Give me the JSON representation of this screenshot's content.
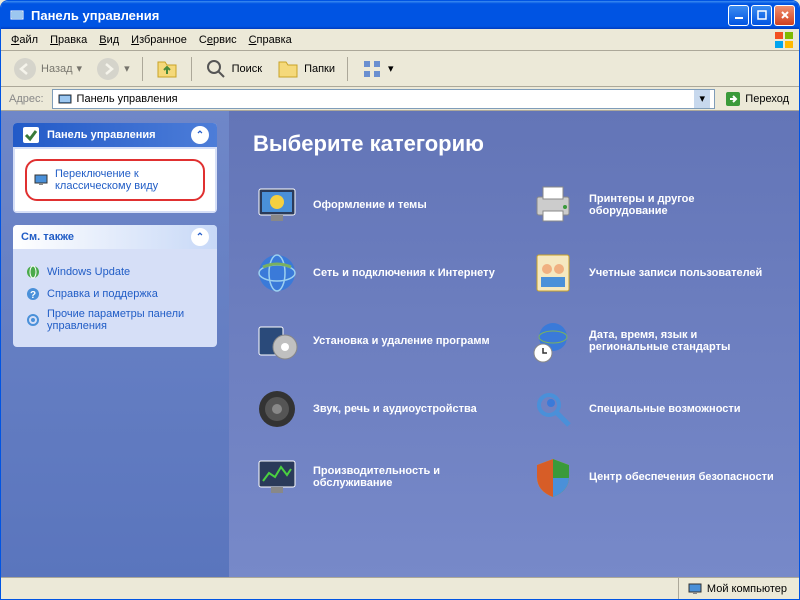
{
  "window": {
    "title": "Панель управления"
  },
  "menu": {
    "file": "Файл",
    "edit": "Правка",
    "view": "Вид",
    "favorites": "Избранное",
    "tools": "Сервис",
    "help": "Справка"
  },
  "toolbar": {
    "back": "Назад",
    "search": "Поиск",
    "folders": "Папки"
  },
  "addressbar": {
    "label": "Адрес:",
    "value": "Панель управления",
    "go": "Переход"
  },
  "sidebar": {
    "panel1": {
      "title": "Панель управления",
      "switch_view": "Переключение к классическому виду"
    },
    "panel2": {
      "title": "См. также",
      "links": [
        "Windows Update",
        "Справка и поддержка",
        "Прочие параметры панели управления"
      ]
    }
  },
  "main": {
    "heading": "Выберите категорию",
    "categories": [
      "Оформление и темы",
      "Принтеры и другое оборудование",
      "Сеть и подключения к Интернету",
      "Учетные записи пользователей",
      "Установка и удаление программ",
      "Дата, время, язык и региональные стандарты",
      "Звук, речь и аудиоустройства",
      "Специальные возможности",
      "Производительность и обслуживание",
      "Центр обеспечения безопасности"
    ]
  },
  "statusbar": {
    "location": "Мой компьютер"
  }
}
